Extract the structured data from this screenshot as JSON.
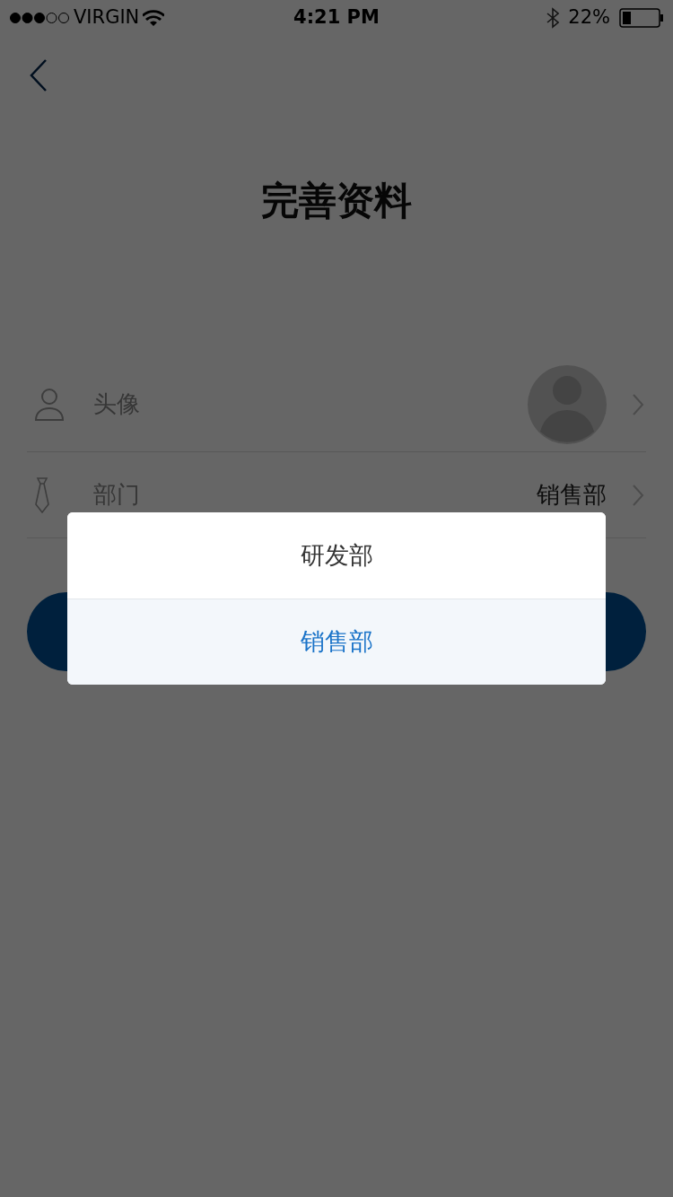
{
  "status_bar": {
    "carrier": "VIRGIN",
    "time": "4:21 PM",
    "battery": "22%"
  },
  "title": "完善资料",
  "rows": [
    {
      "kind": "avatar",
      "label": "头像"
    },
    {
      "kind": "value",
      "label": "部门",
      "value": "销售部"
    }
  ],
  "picker": {
    "options": [
      {
        "label": "研发部",
        "selected": false
      },
      {
        "label": "销售部",
        "selected": true
      }
    ]
  }
}
